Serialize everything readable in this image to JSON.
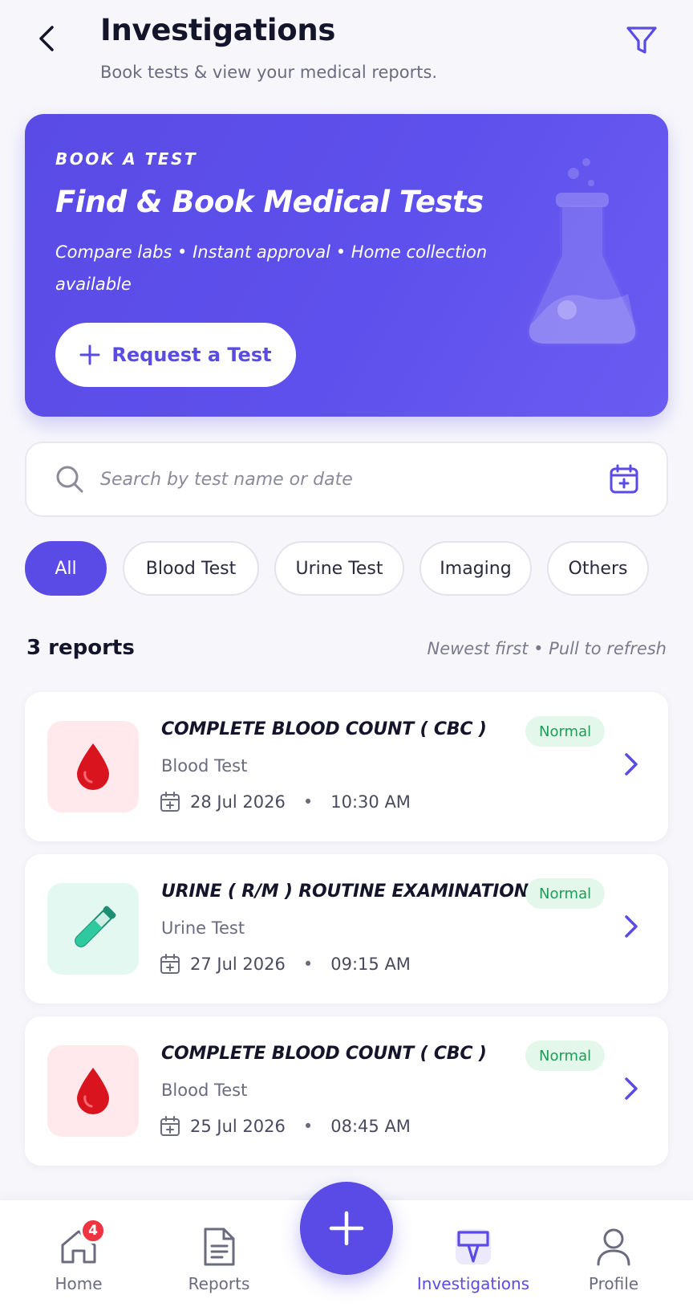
{
  "header": {
    "title": "Investigations",
    "subtitle": "Book tests & view your medical reports."
  },
  "hero": {
    "eyebrow": "BOOK A TEST",
    "title": "Find & Book Medical Tests",
    "description": "Compare labs • Instant approval • Home collection available",
    "button_label": "Request a Test"
  },
  "search": {
    "placeholder": "Search by test name or date",
    "value": ""
  },
  "filters": {
    "chips": [
      "All",
      "Blood Test",
      "Urine Test",
      "Imaging",
      "Others"
    ],
    "active": "All"
  },
  "list_header": {
    "count": "3 reports",
    "hint": "Newest first • Pull to refresh"
  },
  "reports": [
    {
      "title": "COMPLETE BLOOD COUNT ( CBC )",
      "category": "Blood Test",
      "date": "28 Jul 2026",
      "time": "10:30 AM",
      "status": "Normal",
      "icon": "blood-drop-icon"
    },
    {
      "title": "URINE ( R/M ) ROUTINE EXAMINATION",
      "category": "Urine Test",
      "date": "27 Jul 2026",
      "time": "09:15 AM",
      "status": "Normal",
      "icon": "test-tube-icon"
    },
    {
      "title": "COMPLETE BLOOD COUNT ( CBC )",
      "category": "Blood Test",
      "date": "25 Jul 2026",
      "time": "08:45 AM",
      "status": "Normal",
      "icon": "blood-drop-icon"
    }
  ],
  "nav": {
    "items": [
      {
        "label": "Home",
        "icon": "home-icon",
        "badge": "4"
      },
      {
        "label": "Reports",
        "icon": "document-icon"
      },
      {
        "label": "Investigations",
        "icon": "investigations-icon",
        "active": true
      },
      {
        "label": "Profile",
        "icon": "user-icon"
      }
    ]
  },
  "colors": {
    "primary": "#5a4be6",
    "status_normal_bg": "#e3f7ea",
    "status_normal_text": "#1f9d57",
    "badge": "#ef3340"
  }
}
